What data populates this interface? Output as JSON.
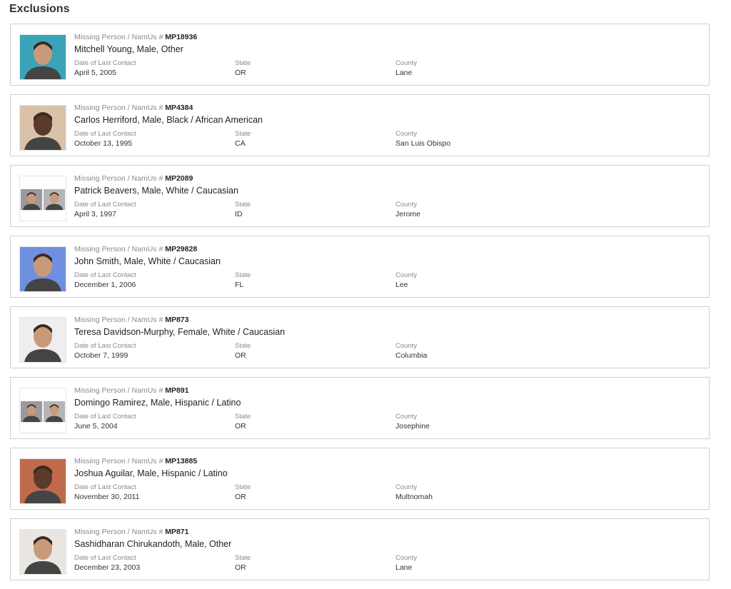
{
  "page": {
    "heading": "Exclusions"
  },
  "labels": {
    "category": "Missing Person / NamUs #",
    "date": "Date of Last Contact",
    "state": "State",
    "county": "County"
  },
  "records": [
    {
      "case": "MP18936",
      "name": "Mitchell Young, Male, Other",
      "date": "April 5, 2005",
      "state": "OR",
      "county": "Lane",
      "photo": "avatar"
    },
    {
      "case": "MP4384",
      "name": "Carlos Herriford, Male, Black / African American",
      "date": "October 13, 1995",
      "state": "CA",
      "county": "San Luis Obispo",
      "photo": "avatar"
    },
    {
      "case": "MP2089",
      "name": "Patrick Beavers, Male, White / Caucasian",
      "date": "April 3, 1997",
      "state": "ID",
      "county": "Jerome",
      "photo": "avatar-pair"
    },
    {
      "case": "MP29828",
      "name": "John Smith, Male, White / Caucasian",
      "date": "December 1, 2006",
      "state": "FL",
      "county": "Lee",
      "photo": "avatar"
    },
    {
      "case": "MP873",
      "name": "Teresa Davidson-Murphy, Female, White / Caucasian",
      "date": "October 7, 1999",
      "state": "OR",
      "county": "Columbia",
      "photo": "avatar"
    },
    {
      "case": "MP891",
      "name": "Domingo Ramirez, Male, Hispanic / Latino",
      "date": "June 5, 2004",
      "state": "OR",
      "county": "Josephine",
      "photo": "avatar-pair"
    },
    {
      "case": "MP13885",
      "name": "Joshua Aguilar, Male, Hispanic / Latino",
      "date": "November 30, 2011",
      "state": "OR",
      "county": "Multnomah",
      "photo": "avatar"
    },
    {
      "case": "MP871",
      "name": "Sashidharan Chirukandoth, Male, Other",
      "date": "December 23, 2003",
      "state": "OR",
      "county": "Lane",
      "photo": "avatar"
    }
  ],
  "photo_colors": [
    "#3aa3b8",
    "#d9c2a8",
    "#e8e8e8",
    "#6f8fe0",
    "#eeeeee",
    "#f2f2f2",
    "#c06a4c",
    "#e9e6e2"
  ]
}
